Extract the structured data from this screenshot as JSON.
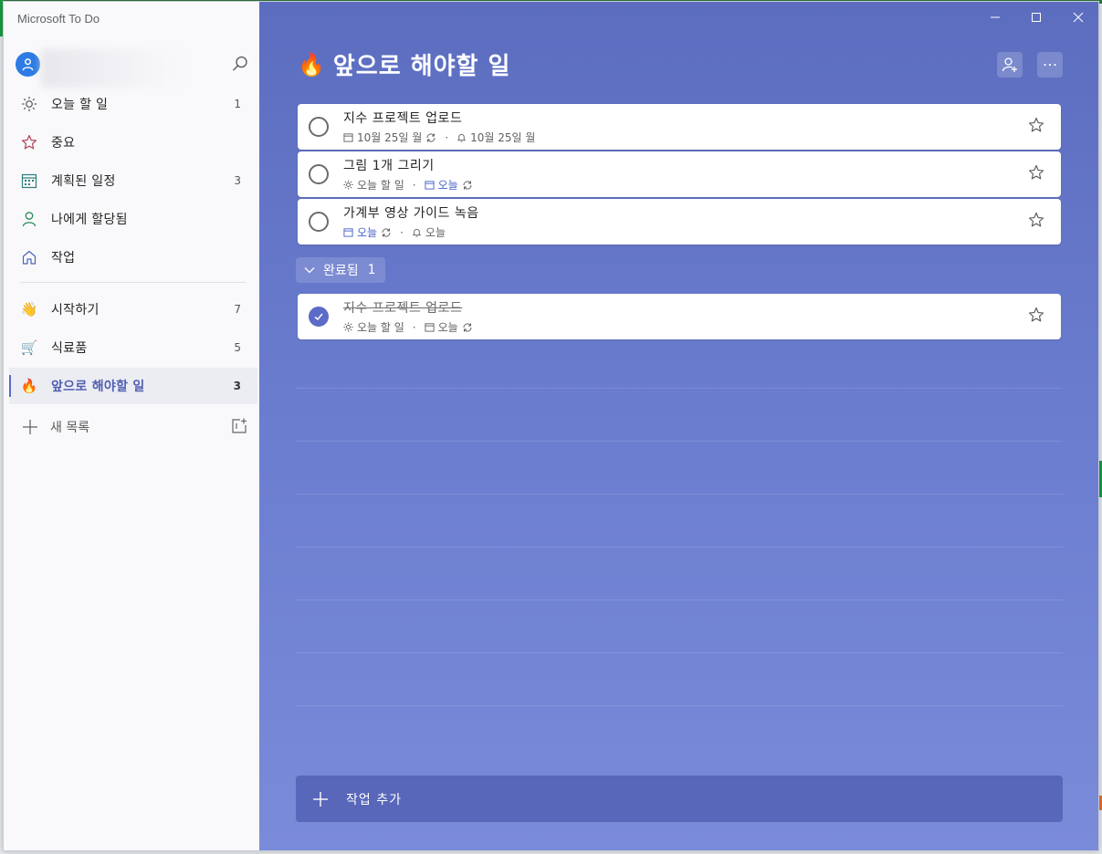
{
  "app": {
    "title": "Microsoft To Do"
  },
  "colors": {
    "accent": "#5b6bc6",
    "main_bg_top": "#5c6dc0",
    "main_bg_bottom": "#7a8bd9",
    "avatar": "#2d7be3"
  },
  "sidebar": {
    "smart_lists": [
      {
        "icon": "sun-icon",
        "label": "오늘 할 일",
        "count": "1"
      },
      {
        "icon": "star-icon",
        "label": "중요",
        "count": ""
      },
      {
        "icon": "calendar-icon",
        "label": "계획된 일정",
        "count": "3"
      },
      {
        "icon": "person-icon",
        "label": "나에게 할당됨",
        "count": ""
      },
      {
        "icon": "home-icon",
        "label": "작업",
        "count": ""
      }
    ],
    "lists": [
      {
        "emoji": "👋",
        "label": "시작하기",
        "count": "7"
      },
      {
        "emoji": "🛒",
        "label": "식료품",
        "count": "5"
      },
      {
        "emoji": "🔥",
        "label": "앞으로 해야할 일",
        "count": "3",
        "active": true
      }
    ],
    "new_list_label": "새 목록"
  },
  "main": {
    "title_emoji": "🔥",
    "title": "앞으로 해야할 일",
    "tasks": [
      {
        "title": "지수 프로젝트 업로드",
        "meta": [
          "10월 25일 월",
          "10월 25일 월"
        ],
        "completed": false
      },
      {
        "title": "그림 1개 그리기",
        "meta": [
          "오늘 할 일",
          "오늘"
        ],
        "completed": false
      },
      {
        "title": "가계부 영상 가이드 녹음",
        "meta": [
          "오늘",
          "오늘"
        ],
        "completed": false
      }
    ],
    "completed_section": {
      "label": "완료됨",
      "count": "1"
    },
    "completed_tasks": [
      {
        "title": "지수 프로젝트 업로드",
        "meta": [
          "오늘 할 일",
          "오늘"
        ],
        "completed": true
      }
    ],
    "add_task_label": "작업 추가"
  }
}
